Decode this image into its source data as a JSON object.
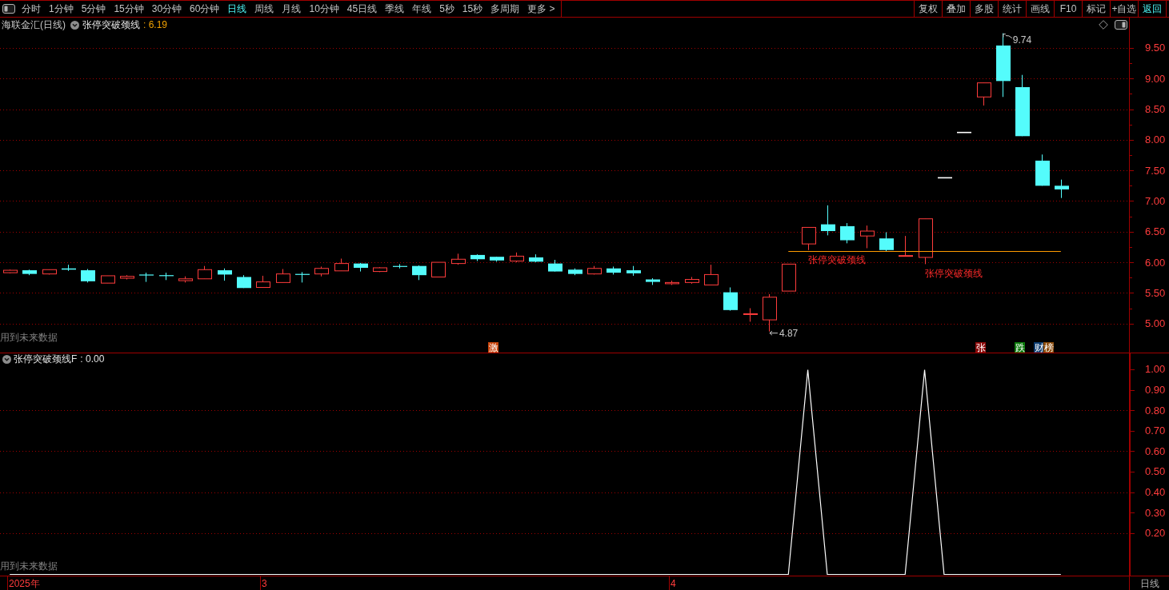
{
  "toolbar": {
    "period_tabs": [
      {
        "label": "分时",
        "selected": false
      },
      {
        "label": "1分钟",
        "selected": false
      },
      {
        "label": "5分钟",
        "selected": false
      },
      {
        "label": "15分钟",
        "selected": false
      },
      {
        "label": "30分钟",
        "selected": false
      },
      {
        "label": "60分钟",
        "selected": false
      },
      {
        "label": "日线",
        "selected": true
      },
      {
        "label": "周线",
        "selected": false
      },
      {
        "label": "月线",
        "selected": false
      },
      {
        "label": "10分钟",
        "selected": false
      },
      {
        "label": "45日线",
        "selected": false
      },
      {
        "label": "季线",
        "selected": false
      },
      {
        "label": "年线",
        "selected": false
      },
      {
        "label": "5秒",
        "selected": false
      },
      {
        "label": "15秒",
        "selected": false
      },
      {
        "label": "多周期",
        "selected": false
      },
      {
        "label": "更多 >",
        "selected": false
      }
    ],
    "tools": [
      {
        "label": "复权",
        "highlighted": false
      },
      {
        "label": "叠加",
        "highlighted": false
      },
      {
        "label": "多股",
        "highlighted": false
      },
      {
        "label": "统计",
        "highlighted": false
      },
      {
        "label": "画线",
        "highlighted": false
      },
      {
        "label": "F10",
        "highlighted": false
      },
      {
        "label": "标记",
        "highlighted": false
      },
      {
        "label": "+自选",
        "highlighted": false
      },
      {
        "label": "返回",
        "highlighted": true
      }
    ]
  },
  "price_chart": {
    "security": "海联金汇(日线)",
    "indicator": {
      "name": "张停突破颈线",
      "value": ": 6.19"
    },
    "notice": "用到未来数据",
    "chart_data": {
      "type": "candlestick",
      "grid": true,
      "ylim": [
        4.526,
        9.996
      ],
      "yticks": [
        {
          "value": 5,
          "label": "5.00"
        },
        {
          "value": 5.5,
          "label": "5.50"
        },
        {
          "value": 6,
          "label": "6.00"
        },
        {
          "value": 6.5,
          "label": "6.50"
        },
        {
          "value": 7,
          "label": "7.00"
        },
        {
          "value": 7.5,
          "label": "7.50"
        },
        {
          "value": 8,
          "label": "8.00"
        },
        {
          "value": 8.5,
          "label": "8.50"
        },
        {
          "value": 9,
          "label": "9.00"
        },
        {
          "value": 9.5,
          "label": "9.50"
        }
      ],
      "ohlc": [
        [
          5.83,
          5.88,
          5.82,
          5.87
        ],
        [
          5.87,
          5.88,
          5.79,
          5.81
        ],
        [
          5.81,
          5.88,
          5.8,
          5.88
        ],
        [
          5.9,
          5.96,
          5.86,
          5.88
        ],
        [
          5.87,
          5.89,
          5.67,
          5.69
        ],
        [
          5.66,
          5.78,
          5.66,
          5.78
        ],
        [
          5.74,
          5.79,
          5.72,
          5.77
        ],
        [
          5.8,
          5.83,
          5.68,
          5.79
        ],
        [
          5.79,
          5.83,
          5.71,
          5.78
        ],
        [
          5.7,
          5.77,
          5.67,
          5.73
        ],
        [
          5.73,
          5.94,
          5.73,
          5.88
        ],
        [
          5.87,
          5.9,
          5.7,
          5.8
        ],
        [
          5.76,
          5.79,
          5.58,
          5.58
        ],
        [
          5.59,
          5.78,
          5.59,
          5.68
        ],
        [
          5.67,
          5.89,
          5.67,
          5.81
        ],
        [
          5.81,
          5.84,
          5.67,
          5.8
        ],
        [
          5.81,
          5.93,
          5.77,
          5.9
        ],
        [
          5.86,
          6.06,
          5.86,
          5.98
        ],
        [
          5.98,
          5.99,
          5.85,
          5.91
        ],
        [
          5.85,
          5.92,
          5.84,
          5.91
        ],
        [
          5.94,
          5.97,
          5.9,
          5.93
        ],
        [
          5.94,
          5.95,
          5.71,
          5.79
        ],
        [
          5.76,
          6.0,
          5.76,
          6.0
        ],
        [
          5.98,
          6.14,
          5.96,
          6.05
        ],
        [
          6.12,
          6.13,
          6.02,
          6.05
        ],
        [
          6.09,
          6.09,
          6.01,
          6.03
        ],
        [
          6.02,
          6.16,
          6.0,
          6.1
        ],
        [
          6.08,
          6.13,
          6.0,
          6.01
        ],
        [
          5.98,
          6.04,
          5.85,
          5.85
        ],
        [
          5.88,
          5.9,
          5.79,
          5.81
        ],
        [
          5.81,
          5.94,
          5.8,
          5.9
        ],
        [
          5.9,
          5.93,
          5.8,
          5.83
        ],
        [
          5.87,
          5.94,
          5.78,
          5.82
        ],
        [
          5.72,
          5.74,
          5.63,
          5.68
        ],
        [
          5.65,
          5.7,
          5.63,
          5.67
        ],
        [
          5.67,
          5.76,
          5.65,
          5.72
        ],
        [
          5.63,
          5.96,
          5.63,
          5.8
        ],
        [
          5.51,
          5.59,
          5.21,
          5.22
        ],
        [
          5.15,
          5.25,
          5.03,
          5.16
        ],
        [
          5.06,
          5.48,
          4.87,
          5.43
        ],
        [
          5.53,
          5.97,
          5.53,
          5.97
        ],
        [
          6.3,
          6.57,
          6.2,
          6.57
        ],
        [
          6.62,
          6.93,
          6.44,
          6.51
        ],
        [
          6.59,
          6.64,
          6.31,
          6.36
        ],
        [
          6.43,
          6.6,
          6.23,
          6.51
        ],
        [
          6.39,
          6.49,
          6.18,
          6.2
        ],
        [
          6.1,
          6.43,
          6.1,
          6.11
        ],
        [
          6.08,
          6.71,
          5.97,
          6.71
        ],
        [
          7.38,
          7.38,
          7.38,
          7.38
        ],
        [
          8.12,
          8.12,
          8.12,
          8.12
        ],
        [
          8.7,
          8.93,
          8.56,
          8.93
        ],
        [
          9.54,
          9.74,
          8.7,
          8.96
        ],
        [
          8.86,
          9.06,
          8.06,
          8.06
        ],
        [
          7.66,
          7.76,
          7.25,
          7.25
        ],
        [
          7.25,
          7.35,
          7.05,
          7.19
        ],
        null,
        null,
        null
      ],
      "ref_lines": [
        {
          "axis": "y",
          "value": 6.19
        }
      ],
      "annotations": [
        "张停突破颈线",
        "张停突破颈线"
      ]
    },
    "extreme_marks": {
      "high": "9.74",
      "low": "4.87"
    },
    "signal_badges": [
      {
        "text": "激",
        "color": "#c8430a"
      },
      {
        "text": "张",
        "color": "#8a0a0a"
      },
      {
        "text": "跌",
        "color": "#0a7a0a"
      },
      {
        "text": "财",
        "color": "#0a3a6e"
      },
      {
        "text": "榜",
        "color": "#8a4a0a"
      }
    ]
  },
  "indicator_chart": {
    "indicator": {
      "name": "张停突破颈线F",
      "value": ": 0.00"
    },
    "notice": "用到未来数据",
    "chart_data": {
      "type": "line",
      "grid": true,
      "ylim": [
        -0.008,
        1.078
      ],
      "yticks": [
        {
          "value": 0.2,
          "label": "0.20"
        },
        {
          "value": 0.3,
          "label": "0.30"
        },
        {
          "value": 0.4,
          "label": "0.40"
        },
        {
          "value": 0.5,
          "label": "0.50"
        },
        {
          "value": 0.6,
          "label": "0.60"
        },
        {
          "value": 0.7,
          "label": "0.70"
        },
        {
          "value": 0.8,
          "label": "0.80"
        },
        {
          "value": 0.9,
          "label": "0.90"
        },
        {
          "value": 1,
          "label": "1.00"
        }
      ],
      "series": [
        {
          "color": "#ffffff",
          "values": [
            0,
            0,
            0,
            0,
            0,
            0,
            0,
            0,
            0,
            0,
            0,
            0,
            0,
            0,
            0,
            0,
            0,
            0,
            0,
            0,
            0,
            0,
            0,
            0,
            0,
            0,
            0,
            0,
            0,
            0,
            0,
            0,
            0,
            0,
            0,
            0,
            0,
            0,
            0,
            0,
            0,
            1,
            0,
            0,
            0,
            0,
            0,
            1,
            0,
            0,
            0,
            0,
            0,
            0,
            0,
            null,
            null,
            null
          ]
        }
      ]
    }
  },
  "date_axis": {
    "labels": [
      "2025年",
      "3",
      "4"
    ],
    "period": "日线"
  }
}
